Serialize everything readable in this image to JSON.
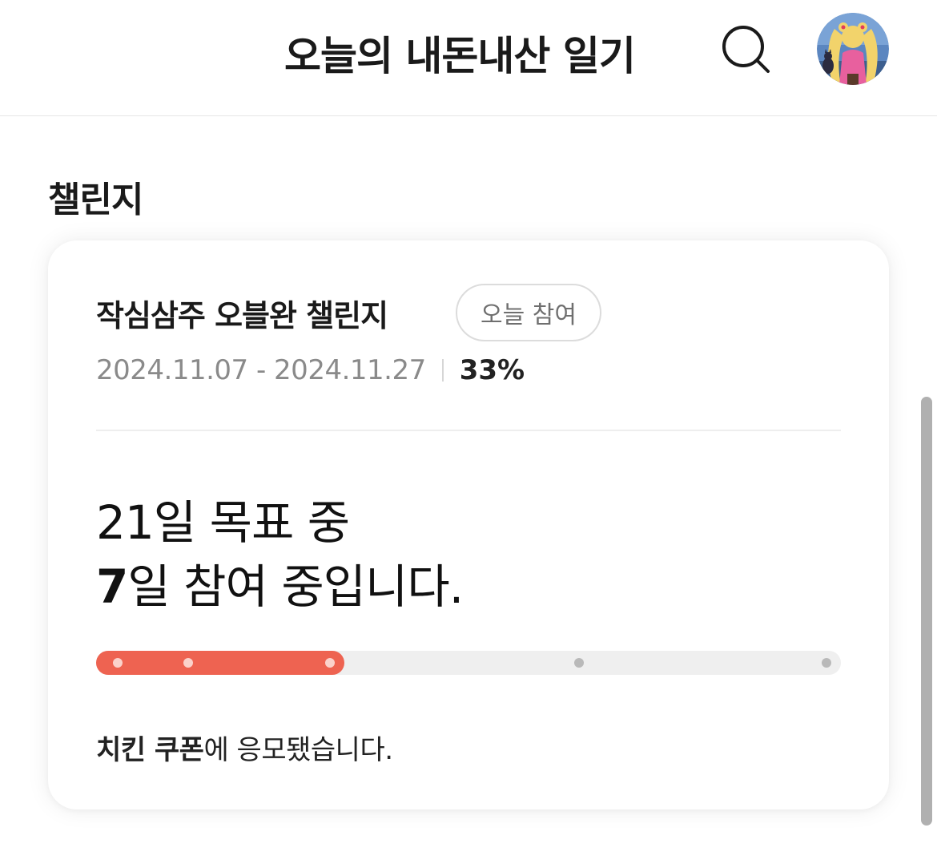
{
  "header": {
    "title": "오늘의 내돈내산 일기",
    "search_icon": "search-icon",
    "avatar": "profile-avatar"
  },
  "section": {
    "title": "챌린지"
  },
  "challenge": {
    "name": "작심삼주 오블완 챌린지",
    "chip_label": "오늘 참여",
    "period": "2024.11.07 - 2024.11.27",
    "percent": "33%",
    "progress_fraction": 0.333,
    "goal_line1": "21일 목표 중",
    "participated_days": "7",
    "goal_line2_rest": "일 참여 중입니다.",
    "reward_name": "치킨 쿠폰",
    "reward_rest": "에 응모됐습니다.",
    "milestones": [
      {
        "fraction": 0.029,
        "reached": true
      },
      {
        "fraction": 0.124,
        "reached": true
      },
      {
        "fraction": 0.314,
        "reached": true
      },
      {
        "fraction": 0.648,
        "reached": false
      },
      {
        "fraction": 0.981,
        "reached": false
      }
    ]
  },
  "colors": {
    "accent": "#ee6351",
    "track": "#efefef",
    "text_primary": "#111111",
    "text_secondary": "#8a8a8a"
  }
}
